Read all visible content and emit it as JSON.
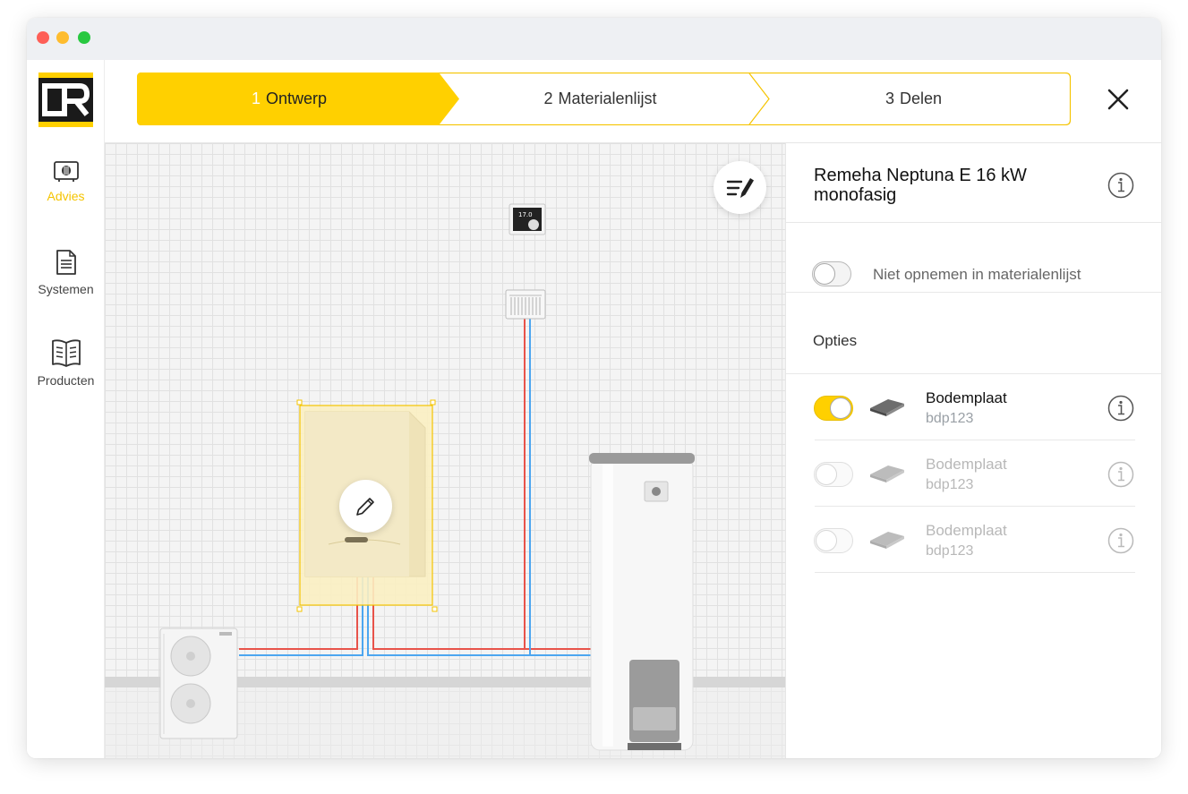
{
  "window": {
    "controls": [
      "close",
      "minimize",
      "maximize"
    ]
  },
  "sidebar": {
    "logo_text": "DR",
    "items": [
      {
        "label": "Advies",
        "icon": "boiler-icon",
        "active": true
      },
      {
        "label": "Systemen",
        "icon": "document-icon",
        "active": false
      },
      {
        "label": "Producten",
        "icon": "book-icon",
        "active": false
      }
    ]
  },
  "stepper": {
    "steps": [
      {
        "number": "1",
        "label": "Ontwerp",
        "active": true
      },
      {
        "number": "2",
        "label": "Materialenlijst",
        "active": false
      },
      {
        "number": "3",
        "label": "Delen",
        "active": false
      }
    ]
  },
  "canvas": {
    "thermostat_display": "17.0",
    "components": [
      "thermostat",
      "radiator",
      "wall-boiler (selected)",
      "outdoor-heat-pump",
      "hot-water-cylinder"
    ]
  },
  "panel": {
    "product_title": "Remeha Neptuna E 16 kW monofasig",
    "exclude_label": "Niet opnemen in materialenlijst",
    "exclude_toggle_on": false,
    "options_heading": "Opties",
    "options": [
      {
        "name": "Bodemplaat",
        "code": "bdp123",
        "enabled": true
      },
      {
        "name": "Bodemplaat",
        "code": "bdp123",
        "enabled": false
      },
      {
        "name": "Bodemplaat",
        "code": "bdp123",
        "enabled": false
      }
    ]
  },
  "colors": {
    "accent": "#FFD000",
    "pipe_supply": "#E8534A",
    "pipe_return": "#4DA6F0"
  }
}
